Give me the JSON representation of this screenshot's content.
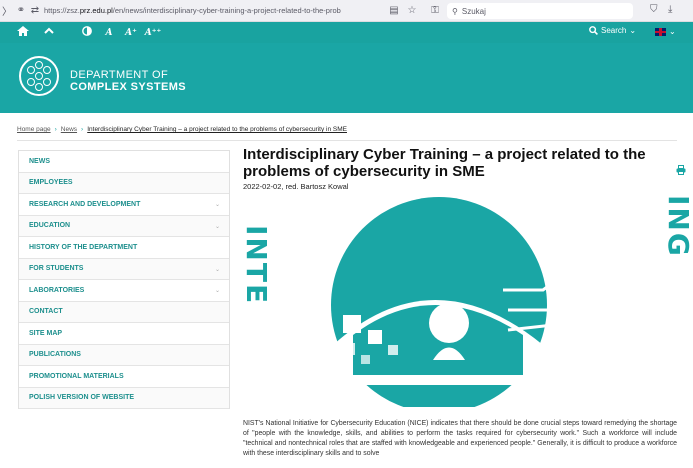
{
  "browser": {
    "url_prefix": "https://zsz.",
    "url_domain": "prz.edu.pl",
    "url_suffix": "/en/news/interdisciplinary-cyber-training-a-project-related-to-the-prob",
    "search_placeholder": "Szukaj",
    "icons": [
      "arrow-left-icon",
      "lock-icon",
      "permissions-icon",
      "reader-icon",
      "star-icon",
      "extension-icon",
      "search-icon",
      "shield-icon",
      "download-icon"
    ]
  },
  "accessibility": {
    "text_small": "A",
    "text_medium": "A⁺",
    "text_large": "A⁺⁺",
    "search_label": "Search"
  },
  "header": {
    "dept_line1": "DEPARTMENT OF",
    "dept_line2": "COMPLEX SYSTEMS"
  },
  "breadcrumb": {
    "home": "Home page",
    "news": "News",
    "current": "Interdisciplinary Cyber Training – a project related to the problems of cybersecurity in SME"
  },
  "sidebar": {
    "items": [
      {
        "label": "NEWS",
        "expandable": false
      },
      {
        "label": "EMPLOYEES",
        "expandable": false
      },
      {
        "label": "RESEARCH AND DEVELOPMENT",
        "expandable": true
      },
      {
        "label": "EDUCATION",
        "expandable": true
      },
      {
        "label": "HISTORY OF THE DEPARTMENT",
        "expandable": false
      },
      {
        "label": "FOR STUDENTS",
        "expandable": true
      },
      {
        "label": "LABORATORIES",
        "expandable": true
      },
      {
        "label": "CONTACT",
        "expandable": false
      },
      {
        "label": "SITE MAP",
        "expandable": false
      },
      {
        "label": "PUBLICATIONS",
        "expandable": false
      },
      {
        "label": "PROMOTIONAL MATERIALS",
        "expandable": false
      },
      {
        "label": "POLISH VERSION OF WEBSITE",
        "expandable": false
      }
    ]
  },
  "article": {
    "title": "Interdisciplinary Cyber Training – a project related to the problems of cybersecurity in SME",
    "meta": "2022-02-02, red. Bartosz Kowal",
    "hero_text_left": "INTE",
    "hero_text_right": "ING",
    "body": "NIST's National Initiative for Cybersecurity Education (NICE) indicates that there should be done crucial steps toward remedying the shortage of \"people with the knowledge, skills, and abilities to perform the tasks required for cybersecurity work.\" Such a workforce will include \"technical and nontechnical roles that are staffed with knowledgeable and experienced people.\" Generally, it is difficult to produce a workforce with these interdisciplinary skills and to solve"
  },
  "colors": {
    "accent": "#1aa6a5",
    "link": "#1d8f8d"
  }
}
